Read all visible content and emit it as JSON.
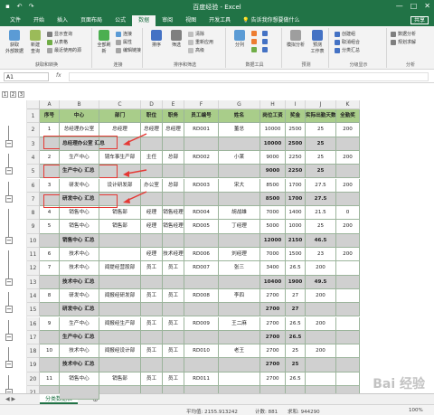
{
  "titlebar": {
    "title": "百度经验 - Excel"
  },
  "tabs": [
    {
      "label": "文件",
      "active": false
    },
    {
      "label": "开始",
      "active": false
    },
    {
      "label": "插入",
      "active": false
    },
    {
      "label": "页面布局",
      "active": false
    },
    {
      "label": "公式",
      "active": false
    },
    {
      "label": "数据",
      "active": true
    },
    {
      "label": "审阅",
      "active": false
    },
    {
      "label": "视图",
      "active": false
    },
    {
      "label": "开发工具",
      "active": false
    }
  ],
  "tell_me": "告诉我你想要做什么",
  "share_label": "共享",
  "ribbon": {
    "get_external": "获取\n外部数据",
    "new_query": "新建\n查询",
    "show_query": "显示查询",
    "from_table": "从表格",
    "recent_sources": "最近使用的源",
    "group_get_transform": "获取和转换",
    "refresh_all": "全部刷新",
    "connections": "连接",
    "properties": "属性",
    "edit_links": "编辑链接",
    "group_connections": "连接",
    "sort": "排序",
    "filter": "筛选",
    "clear": "清除",
    "reapply": "重新应用",
    "advanced": "高级",
    "group_sort_filter": "排序和筛选",
    "text_to_columns": "分列",
    "group_data_tools": "数据工具",
    "what_if": "模拟分析",
    "forecast_sheet": "预测\n工作表",
    "group_forecast": "预测",
    "group": "创建组",
    "ungroup": "取消组合",
    "subtotal": "分类汇总",
    "group_outline": "分级显示",
    "data_analysis": "数据分析",
    "solver": "规划求解",
    "group_analysis": "分析"
  },
  "formula_bar": {
    "namebox": "A1",
    "fx": "fx",
    "value": ""
  },
  "outline_levels": [
    "1",
    "2",
    "3"
  ],
  "columns": [
    "A",
    "B",
    "C",
    "D",
    "E",
    "F",
    "G",
    "H",
    "I",
    "J",
    "K"
  ],
  "rows": [
    {
      "n": "1",
      "type": "head",
      "cells": [
        "序号",
        "中心",
        "部门",
        "职位",
        "职务",
        "员工编号",
        "姓名",
        "岗位工资",
        "奖金",
        "实际出勤天数",
        "全勤奖"
      ]
    },
    {
      "n": "2",
      "type": "data",
      "cells": [
        "1",
        "总经理办公室",
        "总经理",
        "总经理",
        "总经理",
        "RD001",
        "董总",
        "10000",
        "2500",
        "25",
        "200"
      ]
    },
    {
      "n": "3",
      "type": "sum",
      "cells": [
        "",
        "总经理办公室 汇总",
        "",
        "",
        "",
        "",
        "",
        "10000",
        "2500",
        "25",
        ""
      ]
    },
    {
      "n": "4",
      "type": "data",
      "cells": [
        "2",
        "生产中心",
        "镜车事生产部",
        "主任",
        "总部",
        "RD002",
        "小莱",
        "9000",
        "2250",
        "25",
        "200"
      ]
    },
    {
      "n": "5",
      "type": "sum",
      "cells": [
        "",
        "生产中心 汇总",
        "",
        "",
        "",
        "",
        "",
        "9000",
        "2250",
        "25",
        ""
      ]
    },
    {
      "n": "6",
      "type": "data",
      "cells": [
        "3",
        "研发中心",
        "设计研发部",
        "办公室",
        "总部",
        "RD003",
        "宋大",
        "8500",
        "1700",
        "27.5",
        "200"
      ]
    },
    {
      "n": "7",
      "type": "sum",
      "cells": [
        "",
        "研发中心 汇总",
        "",
        "",
        "",
        "",
        "",
        "8500",
        "1700",
        "27.5",
        ""
      ]
    },
    {
      "n": "8",
      "type": "data",
      "cells": [
        "4",
        "销售中心",
        "销售部",
        "经理",
        "销售经理",
        "RD004",
        "胡战雄",
        "7000",
        "1400",
        "21.5",
        "0"
      ]
    },
    {
      "n": "9",
      "type": "data",
      "cells": [
        "5",
        "销售中心",
        "销售部",
        "经理",
        "销售经理",
        "RD005",
        "丁经理",
        "5000",
        "1000",
        "25",
        "200"
      ]
    },
    {
      "n": "10",
      "type": "sum",
      "cells": [
        "",
        "销售中心 汇总",
        "",
        "",
        "",
        "",
        "",
        "12000",
        "2150",
        "46.5",
        ""
      ]
    },
    {
      "n": "11",
      "type": "data",
      "cells": [
        "6",
        "技术中心",
        "",
        "经理",
        "技术经理",
        "RD006",
        "刘经理",
        "7000",
        "1500",
        "23",
        "200"
      ]
    },
    {
      "n": "12",
      "type": "data",
      "cells": [
        "7",
        "技术中心",
        "闻提经营股部",
        "员工",
        "员工",
        "RD007",
        "张三",
        "3400",
        "26.5",
        "200",
        ""
      ]
    },
    {
      "n": "13",
      "type": "sum",
      "cells": [
        "",
        "技术中心 汇总",
        "",
        "",
        "",
        "",
        "",
        "10400",
        "1900",
        "49.5",
        ""
      ]
    },
    {
      "n": "14",
      "type": "data",
      "cells": [
        "8",
        "研发中心",
        "闻报经研发部",
        "员工",
        "员工",
        "RD008",
        "李四",
        "2700",
        "27",
        "200",
        ""
      ]
    },
    {
      "n": "15",
      "type": "sum",
      "cells": [
        "",
        "研发中心 汇总",
        "",
        "",
        "",
        "",
        "",
        "2700",
        "27",
        "",
        ""
      ]
    },
    {
      "n": "16",
      "type": "data",
      "cells": [
        "9",
        "生产中心",
        "闻报经生产部",
        "员工",
        "员工",
        "RD009",
        "王二麻",
        "2700",
        "26.5",
        "200",
        ""
      ]
    },
    {
      "n": "17",
      "type": "sum",
      "cells": [
        "",
        "生产中心 汇总",
        "",
        "",
        "",
        "",
        "",
        "2700",
        "26.5",
        "",
        ""
      ]
    },
    {
      "n": "18",
      "type": "data",
      "cells": [
        "10",
        "技术中心",
        "闻报经设计部",
        "员工",
        "员工",
        "RD010",
        "老王",
        "2700",
        "25",
        "200",
        ""
      ]
    },
    {
      "n": "19",
      "type": "sum",
      "cells": [
        "",
        "技术中心 汇总",
        "",
        "",
        "",
        "",
        "",
        "2700",
        "25",
        "",
        ""
      ]
    },
    {
      "n": "20",
      "type": "data",
      "cells": [
        "11",
        "销售中心",
        "销售部",
        "员工",
        "员工",
        "RD011",
        "",
        "2700",
        "26.5",
        "",
        ""
      ]
    },
    {
      "n": "21",
      "type": "sum",
      "cells": [
        "",
        "",
        "",
        "",
        "",
        "",
        "",
        "",
        "",
        "",
        ""
      ]
    }
  ],
  "sheet_tab": "分类数据表",
  "status": {
    "average": "平均值: 2155.913242",
    "count": "计数: 881",
    "sum": "求和: 944290",
    "zoom": "100%"
  },
  "watermark": "Bai 经验",
  "colors": {
    "excel_green": "#217346",
    "header_green": "#a9cd8a",
    "summary_gray": "#d0d0d0",
    "highlight_red": "#e53935"
  }
}
